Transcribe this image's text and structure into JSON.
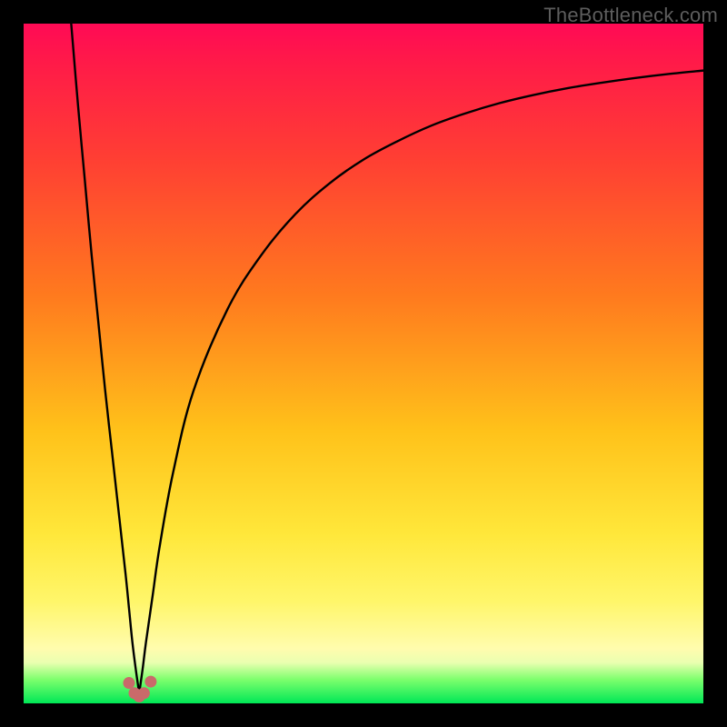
{
  "watermark": "TheBottleneck.com",
  "colors": {
    "frame": "#000000",
    "curve": "#000000",
    "marker": "#c96a6a",
    "gradient_stops": [
      "#ff0a55",
      "#ff1b48",
      "#ff3f33",
      "#ff7a1e",
      "#ffc21a",
      "#ffe73a",
      "#fff66a",
      "#fffcae",
      "#eaffb0",
      "#7dff6d",
      "#00e756"
    ]
  },
  "chart_data": {
    "type": "line",
    "title": "",
    "xlabel": "",
    "ylabel": "",
    "xlim": [
      0,
      100
    ],
    "ylim": [
      0,
      100
    ],
    "grid": false,
    "legend": false,
    "notch_x": 17,
    "series": [
      {
        "name": "left_branch",
        "x": [
          7,
          8,
          9,
          10,
          11,
          12,
          13,
          14,
          15,
          15.5,
          16,
          16.5,
          17
        ],
        "y": [
          100,
          88,
          77,
          66,
          56,
          46,
          37,
          28,
          19,
          14,
          9,
          5,
          1.5
        ]
      },
      {
        "name": "right_branch",
        "x": [
          17,
          17.5,
          18,
          19,
          20,
          22,
          25,
          30,
          35,
          40,
          45,
          50,
          55,
          60,
          65,
          70,
          75,
          80,
          85,
          90,
          95,
          100
        ],
        "y": [
          1.5,
          5,
          9,
          16,
          23,
          34,
          46,
          58,
          66,
          72,
          76.5,
          80,
          82.7,
          85,
          86.8,
          88.3,
          89.5,
          90.5,
          91.3,
          92,
          92.6,
          93.1
        ]
      }
    ],
    "markers": [
      {
        "x": 15.5,
        "y": 3.0
      },
      {
        "x": 16.3,
        "y": 1.5
      },
      {
        "x": 17.0,
        "y": 1.0
      },
      {
        "x": 17.7,
        "y": 1.5
      },
      {
        "x": 18.7,
        "y": 3.2
      }
    ]
  }
}
